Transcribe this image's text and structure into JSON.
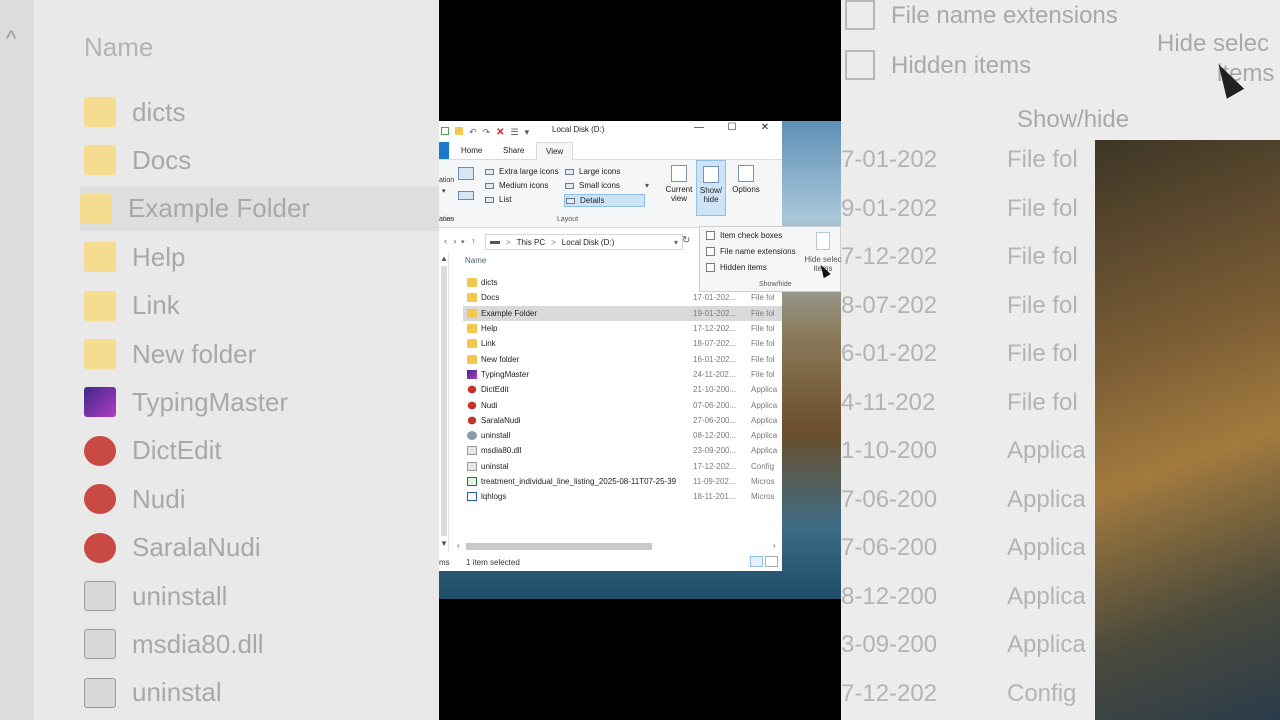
{
  "background_left": {
    "header": "Name",
    "items": [
      "dicts",
      "Docs",
      "Example Folder",
      "Help",
      "Link",
      "New folder",
      "TypingMaster",
      "DictEdit",
      "Nudi",
      "SaralaNudi",
      "uninstall",
      "msdia80.dll",
      "uninstal"
    ]
  },
  "background_right": {
    "file_name_extensions": "File name extensions",
    "hidden_items": "Hidden items",
    "hide_selected": "Hide selec",
    "hide_selected_2": "items",
    "show_hide": "Show/hide",
    "dates": [
      "7-01-202",
      "9-01-202",
      "7-12-202",
      "8-07-202",
      "6-01-202",
      "4-11-202",
      "1-10-200",
      "7-06-200",
      "7-06-200",
      "8-12-200",
      "3-09-200",
      "7-12-202"
    ],
    "types": [
      "File fol",
      "File fol",
      "File fol",
      "File fol",
      "File fol",
      "File fol",
      "Applica",
      "Applica",
      "Applica",
      "Applica",
      "Applica",
      "Config"
    ]
  },
  "window": {
    "title": "Local Disk (D:)",
    "minimize": "—",
    "maximize": "☐",
    "close": "✕",
    "help": "?"
  },
  "ribbon": {
    "tabs": [
      "Home",
      "Share",
      "View"
    ],
    "active_tab": "View",
    "panes_partial": "ation",
    "panes_label": "anes",
    "layout": {
      "extra_large_icons": "Extra large icons",
      "large_icons": "Large icons",
      "medium_icons": "Medium icons",
      "small_icons": "Small icons",
      "list": "List",
      "details": "Details",
      "group_label": "Layout"
    },
    "current_view": [
      "Current",
      "view"
    ],
    "show_hide_btn": [
      "Show/",
      "hide"
    ],
    "options": "Options"
  },
  "show_hide_panel": {
    "item_check_boxes": "Item check boxes",
    "file_name_extensions": "File name extensions",
    "hidden_items": "Hidden items",
    "hide_selected": "Hide selec",
    "hide_selected_2": "items",
    "group_label": "Show/hide"
  },
  "address": {
    "this_pc": "This PC",
    "sep": ">",
    "local_disk": "Local Disk (D:)"
  },
  "list": {
    "header_name": "Name",
    "items": [
      {
        "name": "dicts",
        "date": "",
        "type": "",
        "icon": "folder-icon"
      },
      {
        "name": "Docs",
        "date": "17-01-202...",
        "type": "File fol",
        "icon": "folder-icon"
      },
      {
        "name": "Example Folder",
        "date": "19-01-202...",
        "type": "File fol",
        "icon": "folder-icon"
      },
      {
        "name": "Help",
        "date": "17-12-202...",
        "type": "File fol",
        "icon": "folder-icon"
      },
      {
        "name": "Link",
        "date": "18-07-202...",
        "type": "File fol",
        "icon": "folder-icon"
      },
      {
        "name": "New folder",
        "date": "16-01-202...",
        "type": "File fol",
        "icon": "folder-icon"
      },
      {
        "name": "TypingMaster",
        "date": "24-11-202...",
        "type": "File fol",
        "icon": "typingmaster-icon"
      },
      {
        "name": "DictEdit",
        "date": "21-10-200...",
        "type": "Applica",
        "icon": "dictedit-icon"
      },
      {
        "name": "Nudi",
        "date": "07-06-200...",
        "type": "Applica",
        "icon": "nudi-icon"
      },
      {
        "name": "SaralaNudi",
        "date": "27-06-200...",
        "type": "Applica",
        "icon": "nudi-icon"
      },
      {
        "name": "uninstall",
        "date": "08-12-200...",
        "type": "Applica",
        "icon": "installer-icon"
      },
      {
        "name": "msdia80.dll",
        "date": "23-09-200...",
        "type": "Applica",
        "icon": "dll-icon"
      },
      {
        "name": "uninstal",
        "date": "17-12-202...",
        "type": "Config",
        "icon": "config-file-icon"
      },
      {
        "name": "treatment_individual_line_listing_2025-08-11T07-25-39",
        "date": "11-09-202...",
        "type": "Micros",
        "icon": "excel-icon"
      },
      {
        "name": "lqhlogs",
        "date": "18-11-201...",
        "type": "Micros",
        "icon": "word-icon"
      }
    ],
    "selected": "Example Folder"
  },
  "status": {
    "items_partial": "ms",
    "selected": "1 item selected"
  }
}
